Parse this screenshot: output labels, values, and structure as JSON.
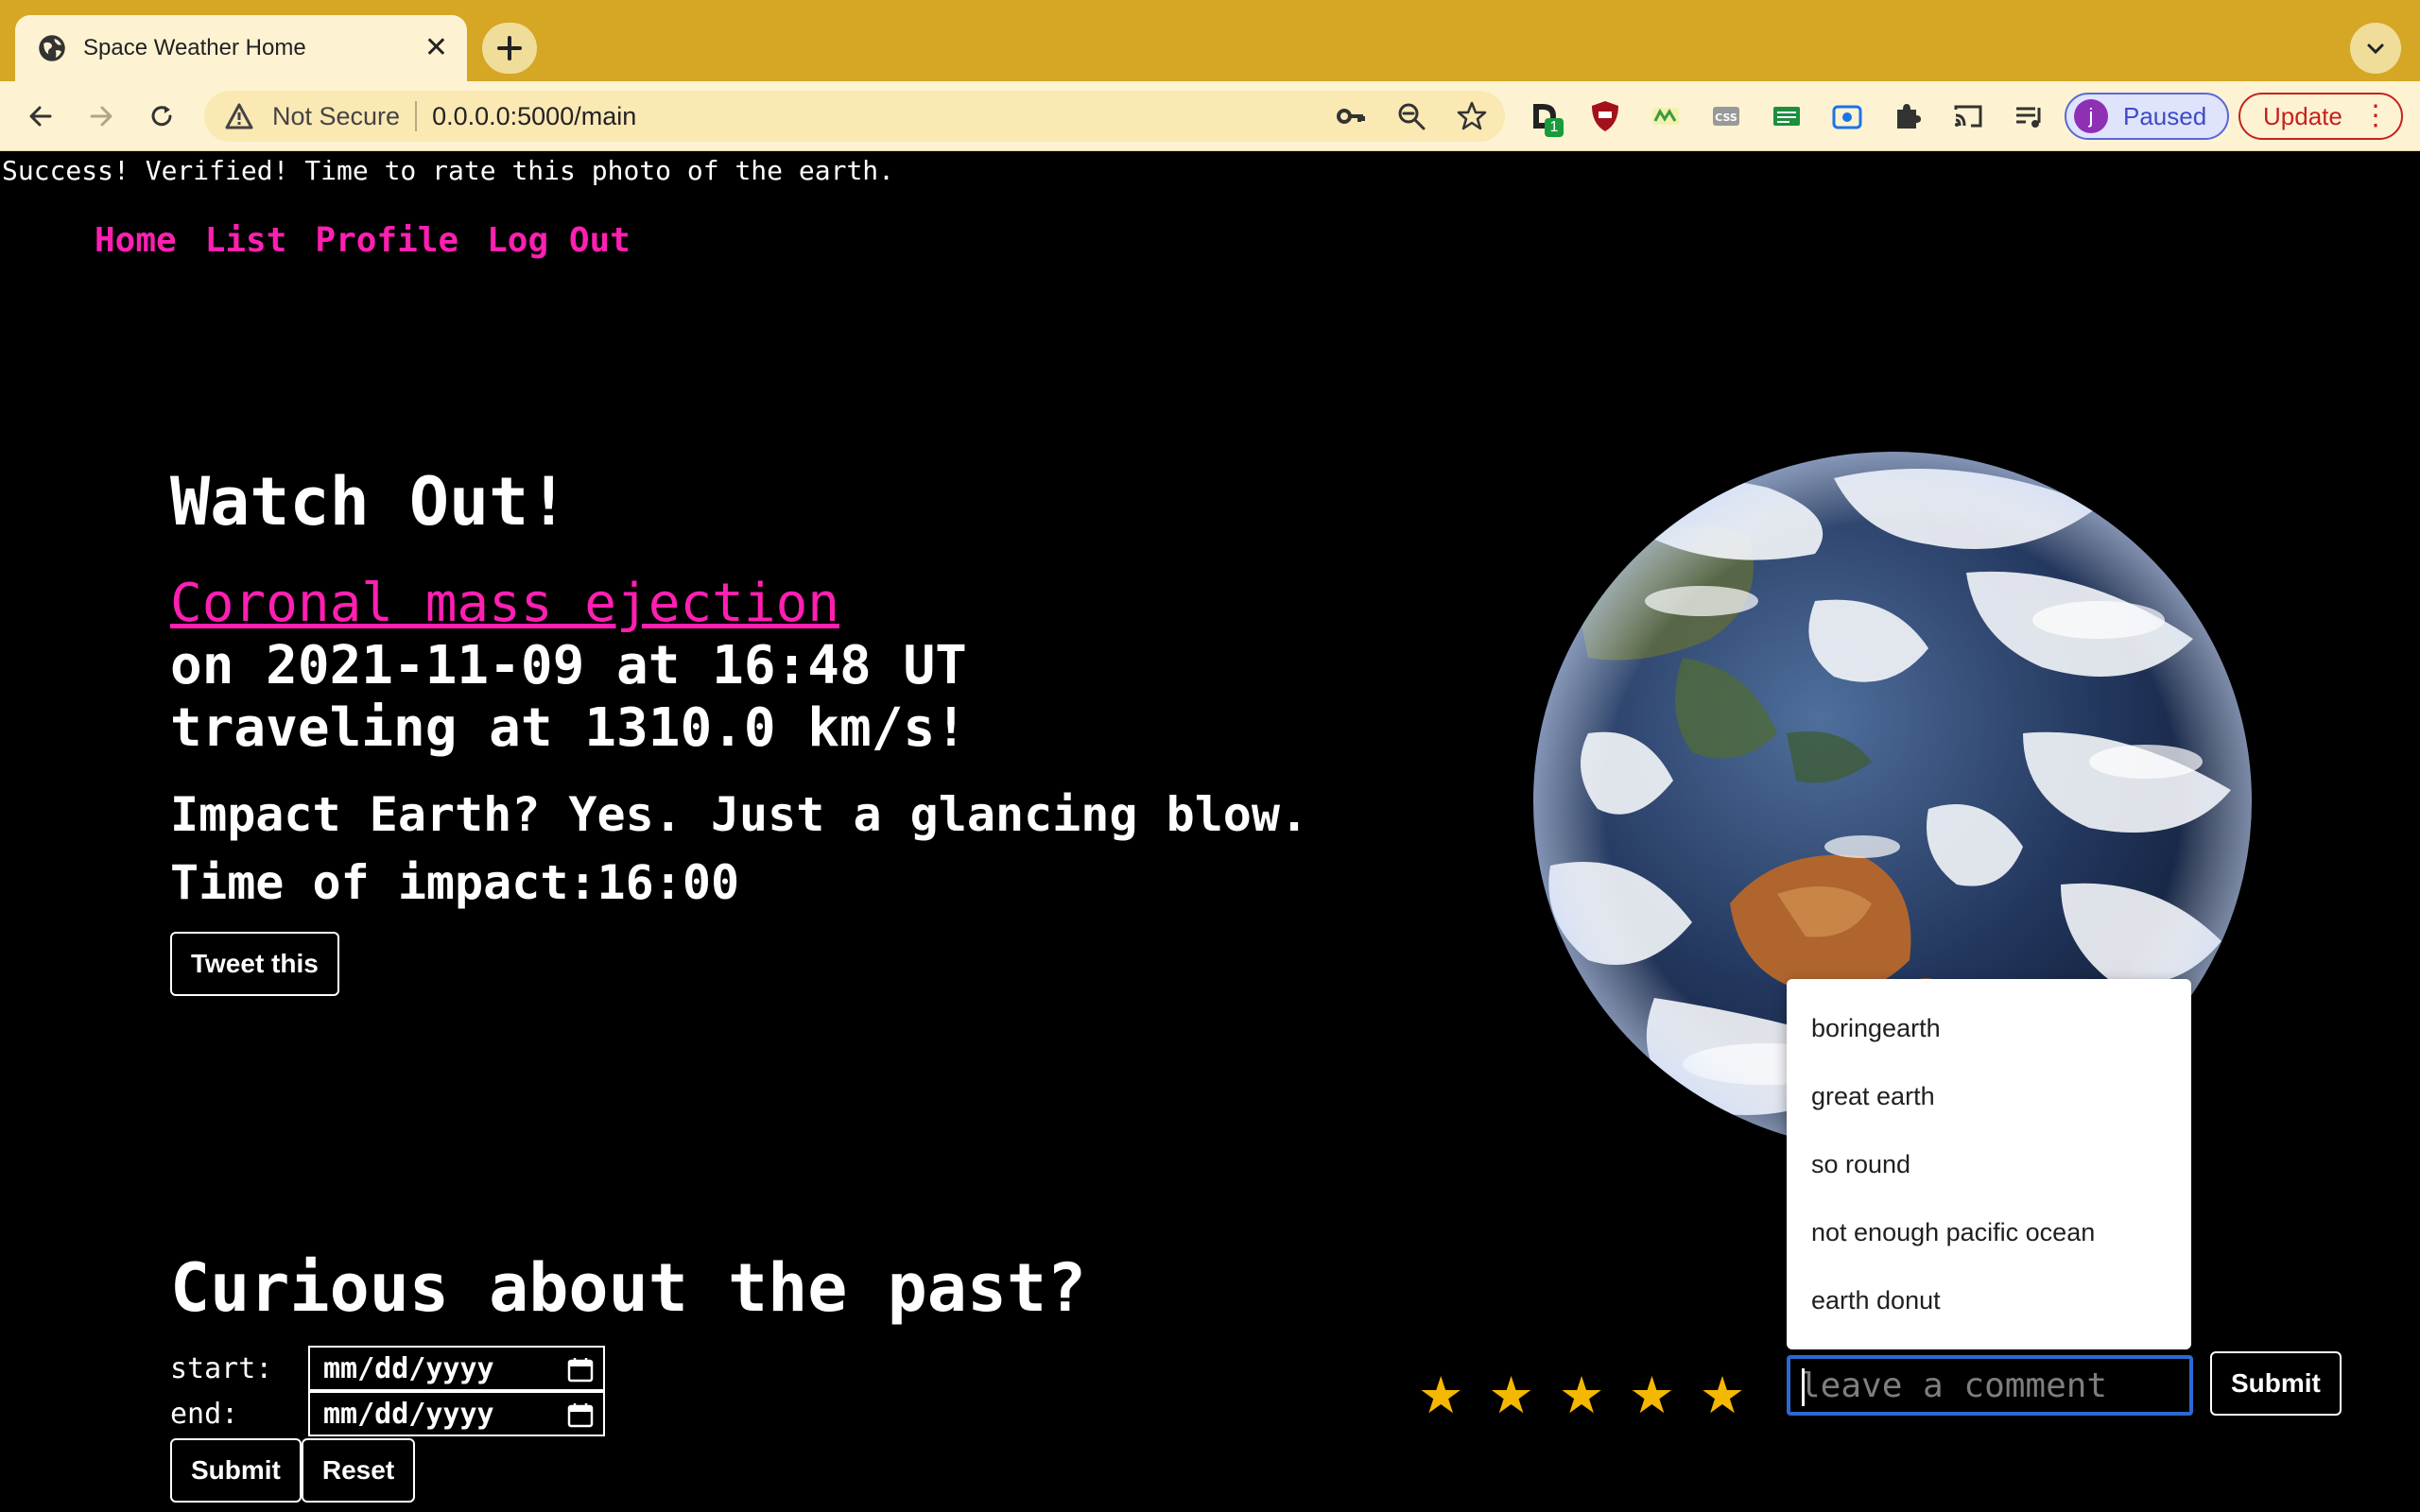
{
  "browser": {
    "tab_title": "Space Weather Home",
    "tab_close": "✕",
    "new_tab": "+",
    "security_label": "Not Secure",
    "url": "0.0.0.0:5000/main",
    "profile_initial": "j",
    "profile_status": "Paused",
    "update_label": "Update",
    "extension_badge": "1"
  },
  "page": {
    "flash_message": "Success! Verified! Time to rate this photo of the earth.",
    "nav": [
      "Home",
      "List",
      "Profile",
      "Log Out"
    ],
    "hero": {
      "heading": "Watch Out!",
      "event_link": "Coronal mass ejection",
      "event_date_line": "on 2021-11-09 at 16:48 UT",
      "event_speed_line": "traveling at 1310.0 km/s!",
      "impact_line": "Impact Earth? Yes. Just a glancing blow.",
      "impact_time_line": "Time of impact:16:00",
      "tweet_button": "Tweet this"
    },
    "past": {
      "heading": "Curious about the past?",
      "start_label": "start:",
      "end_label": "end:",
      "start_placeholder": "mm/dd/yyyy",
      "end_placeholder": "mm/dd/yyyy",
      "submit_button": "Submit",
      "reset_button": "Reset"
    },
    "rating": {
      "stars": [
        "★",
        "★",
        "★",
        "★",
        "★"
      ],
      "star_color": "#f5b800"
    },
    "comment": {
      "placeholder": "leave a comment",
      "submit_button": "Submit",
      "suggestions": [
        "boringearth",
        "great earth",
        "so round",
        "not enough pacific ocean",
        "earth donut"
      ]
    }
  },
  "colors": {
    "tabstrip": "#d6a625",
    "toolbar": "#fdf3d2",
    "link": "#ff1fb1",
    "focus_ring": "#2c69d1"
  }
}
